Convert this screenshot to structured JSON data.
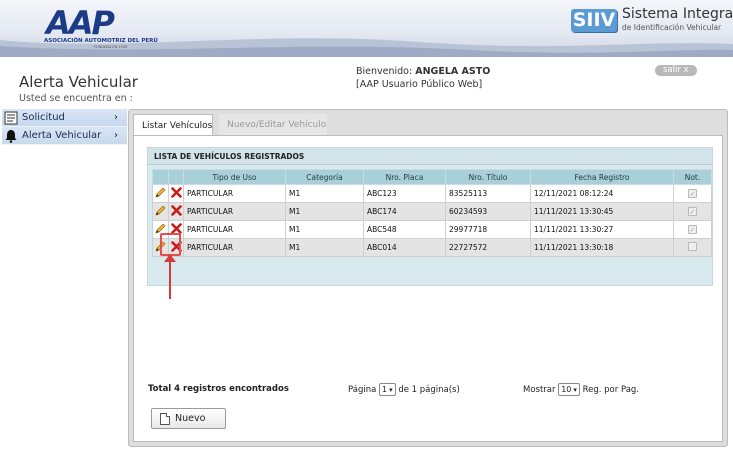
{
  "header": {
    "logo_text": "AAP",
    "logo_subtitle": "ASOCIACIÓN AUTOMOTRIZ DEL PERÚ",
    "logo_founded": "FUNDADA EN 1926",
    "system_badge": "SIIV",
    "system_title": "Sistema Integral",
    "system_subtitle": "de Identificación Vehicular"
  },
  "page": {
    "title": "Alerta Vehicular",
    "breadcrumb_label": "Usted se encuentra en :",
    "welcome_prefix": "Bienvenido:",
    "user_name": "ANGELA ASTO",
    "user_role": "[AAP Usuario Público Web]",
    "logout_label": "salir x"
  },
  "sidebar": {
    "items": [
      {
        "label": "Solicitud",
        "icon": "document-icon",
        "arrow": "›"
      },
      {
        "label": "Alerta Vehicular",
        "icon": "bell-icon",
        "arrow": "›"
      }
    ]
  },
  "tabs": [
    {
      "label": "Listar Vehículos",
      "active": true
    },
    {
      "label": "Nuevo/Editar Vehículo",
      "active": false
    }
  ],
  "list": {
    "title": "LISTA DE VEHÍCULOS REGISTRADOS",
    "columns": [
      "Tipo de Uso",
      "Categoría",
      "Nro. Placa",
      "Nro. Título",
      "Fecha Registro",
      "Not."
    ],
    "rows": [
      {
        "tipo": "PARTICULAR",
        "categoria": "M1",
        "placa": "ABC123",
        "titulo": "83525113",
        "fecha": "12/11/2021 08:12:24",
        "notificacion": true
      },
      {
        "tipo": "PARTICULAR",
        "categoria": "M1",
        "placa": "ABC174",
        "titulo": "60234593",
        "fecha": "11/11/2021 13:30:45",
        "notificacion": true
      },
      {
        "tipo": "PARTICULAR",
        "categoria": "M1",
        "placa": "ABC548",
        "titulo": "29977718",
        "fecha": "11/11/2021 13:30:27",
        "notificacion": true
      },
      {
        "tipo": "PARTICULAR",
        "categoria": "M1",
        "placa": "ABC014",
        "titulo": "22727572",
        "fecha": "11/11/2021 13:30:18",
        "notificacion": false
      }
    ]
  },
  "footer": {
    "total_text": "Total 4 registros encontrados",
    "page_prefix": "Página",
    "page_value": "1",
    "page_suffix": "de 1 página(s)",
    "show_prefix": "Mostrar",
    "show_value": "10",
    "show_suffix": "Reg. por Pag.",
    "new_button": "Nuevo"
  },
  "colors": {
    "accent_blue": "#1d3a86",
    "siiv_blue": "#5b9bd5",
    "table_header": "#a9cfd8",
    "delete_red": "#d42020",
    "annotation_red": "#d63b3b"
  }
}
